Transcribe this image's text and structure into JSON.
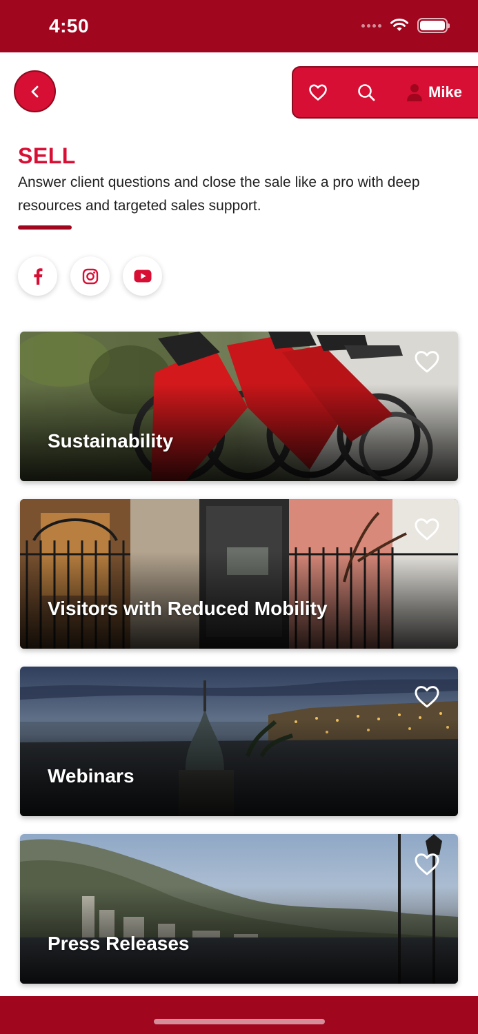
{
  "status_bar": {
    "time": "4:50"
  },
  "header": {
    "back_icon": "chevron-left-icon",
    "favorites_icon": "heart-icon",
    "search_icon": "search-icon",
    "user_icon": "person-icon",
    "user_name": "Mike"
  },
  "section": {
    "title": "SELL",
    "description": "Answer client questions and close the sale like a pro with deep resources and targeted sales support."
  },
  "social": [
    {
      "name": "facebook",
      "icon": "facebook-icon"
    },
    {
      "name": "instagram",
      "icon": "instagram-icon"
    },
    {
      "name": "youtube",
      "icon": "youtube-icon"
    }
  ],
  "cards": [
    {
      "title": "Sustainability",
      "image": "red-rental-bicycles-photo"
    },
    {
      "title": "Visitors with Reduced Mobility",
      "image": "wrought-iron-gate-elevator-photo"
    },
    {
      "title": "Webinars",
      "image": "harbour-at-dusk-photo"
    },
    {
      "title": "Press Releases",
      "image": "mountain-coastline-city-photo"
    }
  ],
  "colors": {
    "brand_dark": "#a1061f",
    "brand_red": "#d70f34",
    "text": "#1f1f1f",
    "white": "#ffffff"
  }
}
